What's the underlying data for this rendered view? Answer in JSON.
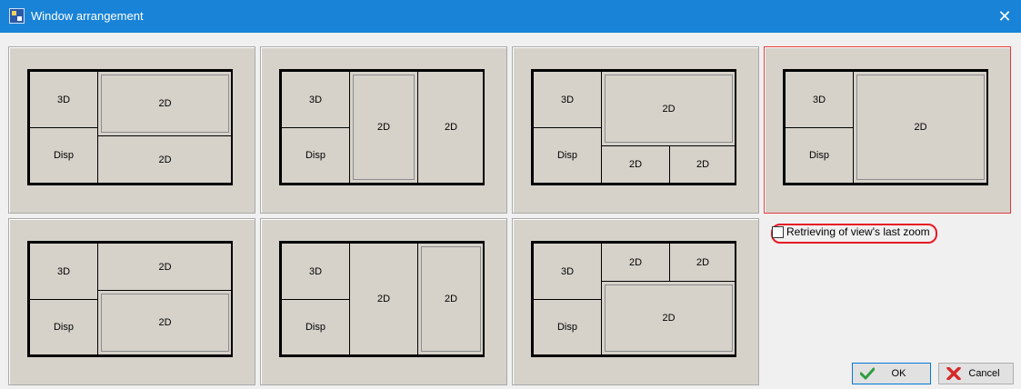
{
  "window": {
    "title": "Window arrangement",
    "close_glyph": "✕"
  },
  "labels": {
    "three_d": "3D",
    "two_d": "2D",
    "disp": "Disp"
  },
  "option": {
    "label": "Retrieving of view's last zoom",
    "checked": false
  },
  "buttons": {
    "ok": "OK",
    "cancel": "Cancel"
  },
  "colors": {
    "accent": "#1883d7",
    "selection": "#e23b3b",
    "highlight_ring": "#e61a23"
  }
}
